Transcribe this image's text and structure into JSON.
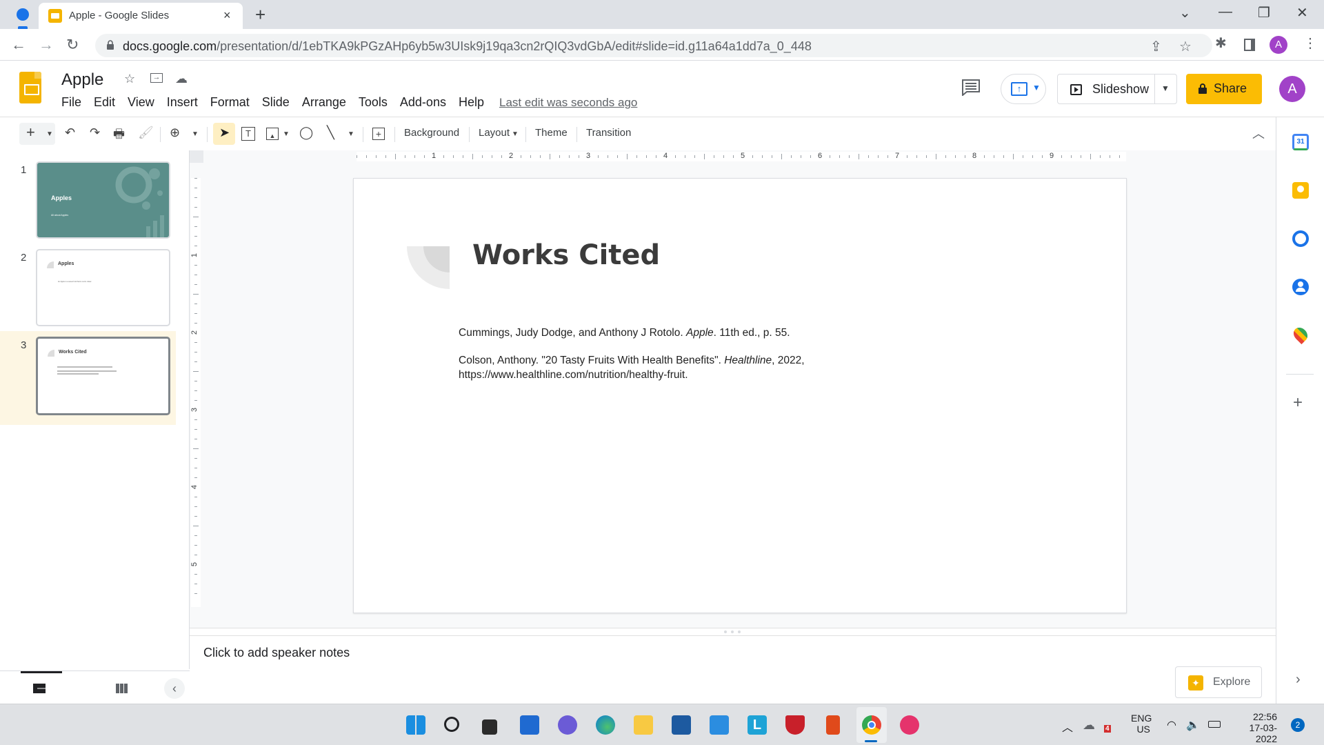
{
  "browser": {
    "tab_title": "Apple - Google Slides",
    "tab_close": "×",
    "new_tab": "+",
    "url_host": "docs.google.com",
    "url_path": "/presentation/d/1ebTKA9kPGzAHp6yb5w3UIsk9j19qa3cn2rQIQ3vdGbA/edit#slide=id.g11a64a1dd7a_0_448",
    "avatar_letter": "A",
    "window_controls": {
      "tab_search": "⌄",
      "minimize": "—",
      "restore": "❐",
      "close": "✕"
    },
    "nav": {
      "back": "←",
      "forward": "→",
      "reload": "↻"
    }
  },
  "app": {
    "doc_title": "Apple",
    "menu": [
      "File",
      "Edit",
      "View",
      "Insert",
      "Format",
      "Slide",
      "Arrange",
      "Tools",
      "Add-ons",
      "Help"
    ],
    "last_edit": "Last edit was seconds ago",
    "slideshow_label": "Slideshow",
    "share_label": "Share",
    "account_letter": "A",
    "accent_colors": {
      "slides_yellow": "#f4b400",
      "share_button": "#fbbc04",
      "avatar_purple": "#a142c8",
      "theme_teal": "#5a8e8a"
    }
  },
  "toolbar": {
    "background_label": "Background",
    "layout_label": "Layout",
    "theme_label": "Theme",
    "transition_label": "Transition"
  },
  "rulers": {
    "horizontal": [
      "1",
      "2",
      "3",
      "4",
      "5",
      "6",
      "7",
      "8",
      "9"
    ],
    "vertical": [
      "1",
      "2",
      "3",
      "4",
      "5"
    ]
  },
  "filmstrip": {
    "slides": [
      {
        "number": "1",
        "title": "Apples",
        "subtitle": "All about Apples",
        "selected": false
      },
      {
        "number": "2",
        "title": "Apples",
        "body": "An Apple is a sweet fruit that is red in colour.",
        "selected": false
      },
      {
        "number": "3",
        "title": "Works Cited",
        "selected": true
      }
    ]
  },
  "slide": {
    "title": "Works Cited",
    "citations": [
      {
        "before": "Cummings, Judy Dodge, and Anthony J Rotolo. ",
        "italic": "Apple",
        "after": ". 11th ed., p. 55."
      },
      {
        "before": "Colson, Anthony. \"20 Tasty Fruits With Health Benefits\". ",
        "italic": "Healthline",
        "after": ", 2022,",
        "line2": "https://www.healthline.com/nutrition/healthy-fruit."
      }
    ]
  },
  "notes": {
    "placeholder": "Click to add speaker notes"
  },
  "explore": {
    "label": "Explore"
  },
  "taskbar": {
    "tray": {
      "language": "ENG",
      "region": "US",
      "time": "22:56",
      "date": "17-03-2022",
      "notification_count": "2",
      "app_badge": "4"
    }
  }
}
